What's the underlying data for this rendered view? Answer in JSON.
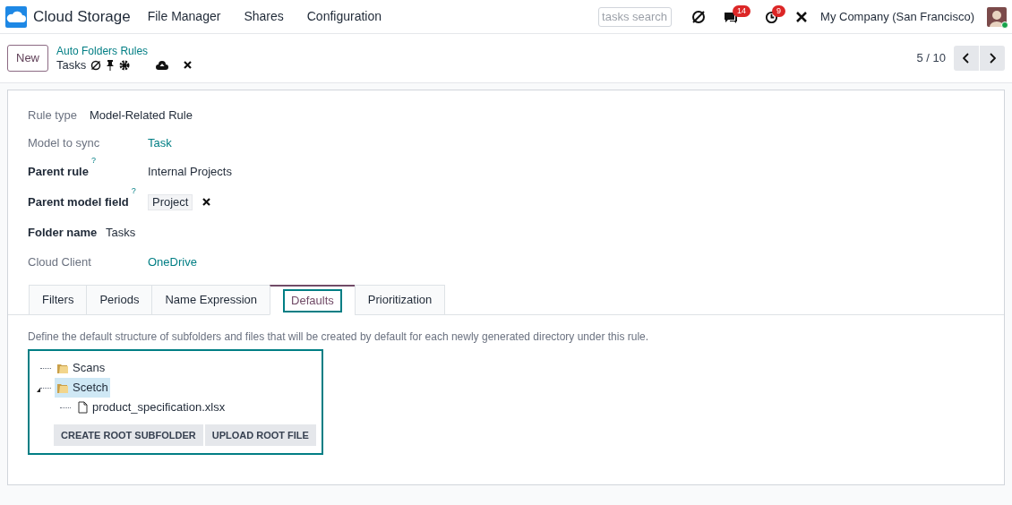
{
  "navbar": {
    "app_name": "Cloud Storage",
    "menu": [
      "File Manager",
      "Shares",
      "Configuration"
    ],
    "search": {
      "placeholder": "tasks search"
    },
    "messages_badge": "14",
    "activities_badge": "9",
    "company": "My Company (San Francisco)"
  },
  "control_panel": {
    "new_button": "New",
    "breadcrumb": "Auto Folders Rules",
    "record_title": "Tasks",
    "pager": "5 / 10"
  },
  "fields": [
    {
      "label": "Rule type",
      "required": false,
      "kind": "text",
      "value": "Model-Related Rule"
    },
    {
      "label": "Model to sync",
      "required": false,
      "kind": "link",
      "value": "Task"
    },
    {
      "label": "Parent rule",
      "required": true,
      "help": "?",
      "kind": "text",
      "value": "Internal Projects"
    },
    {
      "label": "Parent model field",
      "required": true,
      "help": "?",
      "kind": "tag",
      "value": "Project"
    },
    {
      "label": "Folder name",
      "required": true,
      "kind": "text",
      "value": "Tasks"
    },
    {
      "label": "Cloud Client",
      "required": false,
      "kind": "link",
      "value": "OneDrive"
    }
  ],
  "tabs": [
    {
      "label": "Filters",
      "selected": false
    },
    {
      "label": "Periods",
      "selected": false
    },
    {
      "label": "Name Expression",
      "selected": false
    },
    {
      "label": "Defaults",
      "selected": true
    },
    {
      "label": "Prioritization",
      "selected": false
    }
  ],
  "description": "Define the default structure of subfolders and files that will be created by default for each newly generated directory under this rule.",
  "tree": [
    {
      "kind": "folder",
      "label": "Scans",
      "selected": false
    },
    {
      "kind": "folder",
      "label": "Scetch",
      "selected": true,
      "expanded": true,
      "children": [
        {
          "kind": "file",
          "label": "product_specification.xlsx",
          "selected": false
        }
      ]
    }
  ],
  "tree_buttons": [
    "CREATE ROOT SUBFOLDER",
    "UPLOAD ROOT FILE"
  ]
}
